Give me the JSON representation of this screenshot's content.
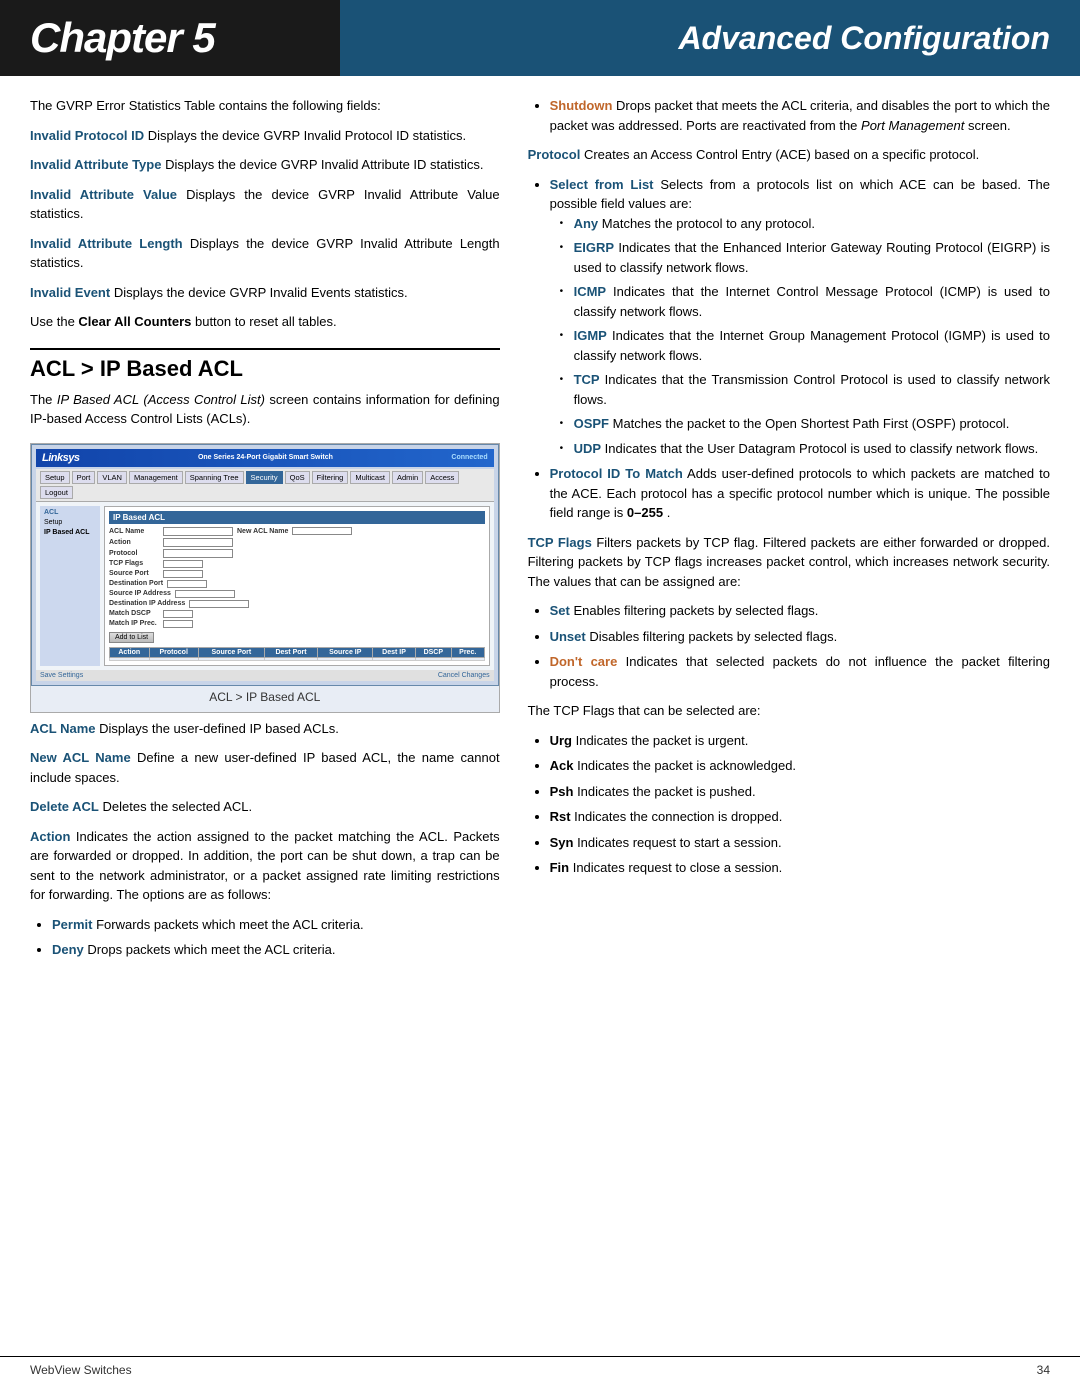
{
  "header": {
    "chapter_label": "Chapter 5",
    "title_label": "Advanced Configuration"
  },
  "footer": {
    "product_name": "WebView Switches",
    "page_number": "34"
  },
  "intro": {
    "paragraph": "The GVRP Error Statistics Table contains the following fields:"
  },
  "gvrp_fields": [
    {
      "term": "Invalid Protocol ID",
      "term_style": "blue",
      "desc": " Displays the device GVRP Invalid Protocol ID statistics."
    },
    {
      "term": "Invalid Attribute Type",
      "term_style": "blue",
      "desc": " Displays the device GVRP Invalid Attribute ID statistics."
    },
    {
      "term": "Invalid Attribute Value",
      "term_style": "blue",
      "desc": " Displays the device GVRP Invalid Attribute Value statistics."
    },
    {
      "term": "Invalid Attribute Length",
      "term_style": "blue",
      "desc": " Displays the device GVRP Invalid Attribute Length statistics."
    },
    {
      "term": "Invalid Event",
      "term_style": "blue",
      "desc": " Displays the device GVRP Invalid Events statistics."
    }
  ],
  "clear_counters_note": "Use the ",
  "clear_counters_bold": "Clear All Counters",
  "clear_counters_end": " button to reset all tables.",
  "section_title": "ACL > IP Based ACL",
  "section_intro": "The IP Based ACL (Access Control List) screen contains information for defining IP-based Access Control Lists (ACLs).",
  "screenshot_caption": "ACL > IP Based ACL",
  "acl_fields": [
    {
      "term": "ACL Name",
      "term_style": "blue",
      "desc": " Displays the user-defined IP based ACLs."
    },
    {
      "term": "New ACL Name",
      "term_style": "blue",
      "desc": " Define a new user-defined IP based ACL, the name cannot include spaces."
    },
    {
      "term": "Delete ACL",
      "term_style": "blue",
      "desc": "  Deletes the selected ACL."
    },
    {
      "term": "Action",
      "term_style": "blue",
      "desc": " Indicates the action assigned to the packet matching the ACL. Packets are forwarded or dropped. In addition, the port can be shut down, a trap can be sent to the network administrator, or a packet assigned rate limiting restrictions for forwarding. The options are as follows:"
    }
  ],
  "action_bullets": [
    {
      "term": "Permit",
      "term_style": "blue",
      "desc": " Forwards packets which meet the ACL criteria."
    },
    {
      "term": "Deny",
      "term_style": "blue",
      "desc": "  Drops packets which meet the ACL criteria."
    }
  ],
  "right_col": {
    "shutdown_bullet": {
      "term": "Shutdown",
      "term_style": "orange",
      "desc": " Drops packet that meets the ACL criteria, and disables the port to which the packet was addressed. Ports are reactivated from the ",
      "italic": "Port Management",
      "desc2": " screen."
    },
    "protocol_intro": {
      "term": "Protocol",
      "term_style": "blue",
      "desc": "  Creates an Access Control Entry (ACE) based on a specific protocol."
    },
    "select_from_list": {
      "term": "Select from List",
      "term_style": "blue",
      "desc": "  Selects from a protocols list on which ACE can be based. The possible field values are:"
    },
    "protocol_options": [
      {
        "term": "Any",
        "term_style": "blue",
        "desc": "  Matches the protocol to any protocol."
      },
      {
        "term": "EIGRP",
        "term_style": "blue",
        "desc": " Indicates that the Enhanced Interior Gateway Routing Protocol (EIGRP) is used to classify network flows."
      },
      {
        "term": "ICMP",
        "term_style": "blue",
        "desc": "  Indicates that the Internet Control Message Protocol (ICMP) is used to classify network flows."
      },
      {
        "term": "IGMP",
        "term_style": "blue",
        "desc": " Indicates that the Internet Group Management Protocol (IGMP) is used to classify network flows."
      },
      {
        "term": "TCP",
        "term_style": "blue",
        "desc": " Indicates that the Transmission Control Protocol is used to classify network flows."
      },
      {
        "term": "OSPF",
        "term_style": "blue",
        "desc": " Matches the packet to the Open Shortest Path First (OSPF) protocol."
      },
      {
        "term": "UDP",
        "term_style": "blue",
        "desc": " Indicates that the User Datagram Protocol is used to classify network flows."
      }
    ],
    "protocol_id_bullet": {
      "term": "Protocol ID To Match",
      "term_style": "blue",
      "desc": "  Adds user-defined protocols to which packets are matched to the ACE. Each protocol has a specific protocol number which is unique. The possible field range is ",
      "bold_range": "0–255",
      "desc2": "."
    },
    "tcp_flags": {
      "term": "TCP Flags",
      "term_style": "blue",
      "desc": " Filters packets by TCP flag. Filtered packets are either forwarded or dropped. Filtering packets by TCP flags increases packet control, which increases network security. The values that can be assigned are:"
    },
    "tcp_flag_options": [
      {
        "term": "Set",
        "term_style": "blue",
        "desc": "  Enables filtering packets by selected flags."
      },
      {
        "term": "Unset",
        "term_style": "blue",
        "desc": "  Disables filtering packets by selected flags."
      },
      {
        "term": "Don't care",
        "term_style": "orange",
        "desc": "  Indicates that selected packets do not influence the packet filtering process."
      }
    ],
    "tcp_flags_note": "The TCP Flags that can be selected are:",
    "tcp_flags_items": [
      {
        "term": "Urg",
        "desc": "  Indicates the packet is urgent."
      },
      {
        "term": "Ack",
        "desc": "  Indicates the packet is acknowledged."
      },
      {
        "term": "Psh",
        "desc": "  Indicates the packet is pushed."
      },
      {
        "term": "Rst",
        "desc": "  Indicates the connection is dropped."
      },
      {
        "term": "Syn",
        "desc": "  Indicates request to start a session."
      },
      {
        "term": "Fin",
        "desc": "  Indicates request to close a session."
      }
    ]
  },
  "ui_mockup": {
    "logo": "Linksys",
    "product": "One Series 24-Port Gigabit Smart Switch",
    "nav_items": [
      "Setup",
      "Port",
      "VLAN",
      "Management",
      "Spanning Tree",
      "Security",
      "QoS",
      "Filtering",
      "Multicast",
      "Admin",
      "Access",
      "Logout"
    ],
    "active_nav": "ACL",
    "sidebar_items": [
      "ACL",
      "Setup",
      "IP Based ACL"
    ],
    "title": "IP Based ACL",
    "table_headers": [
      "Action",
      "Protocol",
      "Source Port",
      "Destination Port",
      "Source IP Address",
      "Destination IP Address",
      "Match DSCP",
      "Match IP Precedence"
    ],
    "button_label": "Add to List"
  }
}
